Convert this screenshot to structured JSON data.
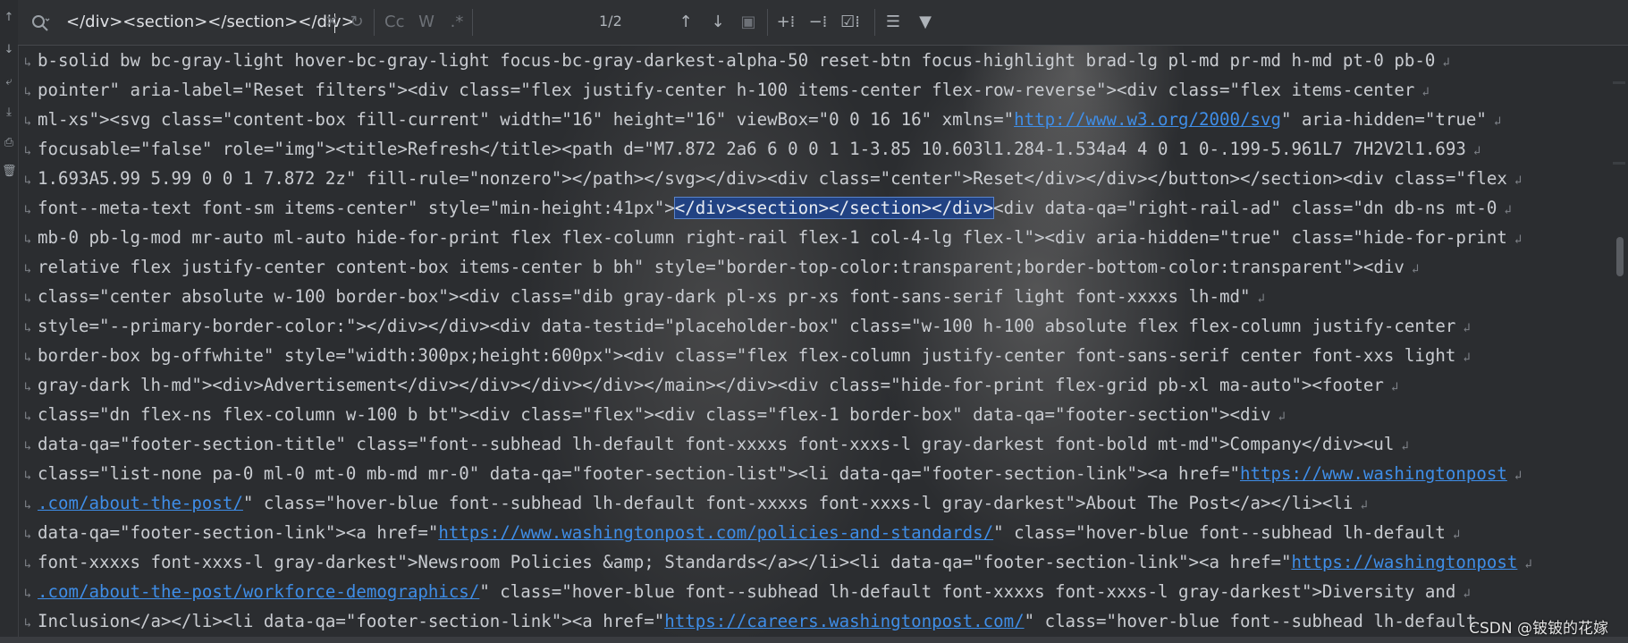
{
  "search": {
    "query": "</div><section></section></div>",
    "match_count": "1/2",
    "buttons": {
      "match_case": "Cc",
      "words": "W",
      "regex": ".*"
    }
  },
  "code_lines": [
    "b-solid bw bc-gray-light hover-bc-gray-light focus-bc-gray-darkest-alpha-50 reset-btn focus-highlight brad-lg pl-md pr-md h-md pt-0 pb-0",
    "pointer\" aria-label=\"Reset filters\"><div class=\"flex justify-center h-100 items-center flex-row-reverse\"><div class=\"flex items-center",
    "ml-xs\"><svg class=\"content-box fill-current\" width=\"16\" height=\"16\" viewBox=\"0 0 16 16\" xmlns=\"",
    "focusable=\"false\" role=\"img\"><title>Refresh</title><path d=\"M7.872 2a6 6 0 0 1 1-3.85 10.603l1.284-1.534a4 4 0 1 0-.199-5.961L7 7H2V2l1.693",
    "1.693A5.99 5.99 0 0 1 7.872 2z\" fill-rule=\"nonzero\"></path></svg></div><div class=\"center\">Reset</div></div></button></section><div class=\"flex",
    "font--meta-text font-sm items-center\" style=\"min-height:41px\">",
    "mb-0 pb-lg-mod mr-auto ml-auto hide-for-print flex flex-column right-rail flex-1 col-4-lg flex-l\"><div aria-hidden=\"true\" class=\"hide-for-print",
    "relative flex justify-center content-box items-center b bh\" style=\"border-top-color:transparent;border-bottom-color:transparent\"><div",
    "class=\"center absolute w-100 border-box\"><div class=\"dib gray-dark pl-xs pr-xs font-sans-serif light font-xxxxs lh-md\"",
    "style=\"--primary-border-color:\"></div></div><div data-testid=\"placeholder-box\" class=\"w-100 h-100 absolute flex flex-column justify-center",
    "border-box bg-offwhite\" style=\"width:300px;height:600px\"><div class=\"flex flex-column justify-center font-sans-serif center font-xxs light",
    "gray-dark lh-md\"><div>Advertisement</div></div></div></div></main></div><div class=\"hide-for-print flex-grid pb-xl ma-auto\"><footer",
    "class=\"dn flex-ns flex-column w-100 b bt\"><div class=\"flex\"><div class=\"flex-1 border-box\" data-qa=\"footer-section\"><div",
    "data-qa=\"footer-section-title\" class=\"font--subhead lh-default font-xxxxs font-xxxs-l gray-darkest font-bold mt-md\">Company</div><ul",
    "class=\"list-none pa-0 ml-0 mt-0 mb-md mr-0\" data-qa=\"footer-section-list\"><li data-qa=\"footer-section-link\"><a href=\"",
    "\" class=\"hover-blue font--subhead lh-default font-xxxxs font-xxxs-l gray-darkest\">About The Post</a></li><li",
    "data-qa=\"footer-section-link\"><a href=\"",
    "font-xxxxs font-xxxs-l gray-darkest\">Newsroom Policies &amp; Standards</a></li><li data-qa=\"footer-section-link\"><a href=\"",
    "\" class=\"hover-blue font--subhead lh-default font-xxxxs font-xxxs-l gray-darkest\">Diversity and",
    "Inclusion</a></li><li data-qa=\"footer-section-link\"><a href=\""
  ],
  "code_parts": {
    "l2_link": "http://www.w3.org/2000/svg",
    "l2_tail": "\" aria-hidden=\"true\"",
    "l5_match": "</div><section></section></div>",
    "l5_tail": "<div data-qa=\"right-rail-ad\" class=\"dn db-ns mt-0",
    "l14_link": "https://www.washingtonpost",
    "l15_link": ".com/about-the-post/",
    "l16_link": "https://www.washingtonpost.com/policies-and-standards/",
    "l16_tail": "\" class=\"hover-blue font--subhead lh-default",
    "l17_link": "https://washingtonpost",
    "l18_link": ".com/about-the-post/workforce-demographics/",
    "l19_link": "https://careers.washingtonpost.com/",
    "l19_tail": "\" class=\"hover-blue font--subhead lh-default"
  },
  "watermark": "CSDN @铍铍的花嫁",
  "icons": {
    "search": "magnifier-icon",
    "clear": "close-icon",
    "history": "history-icon",
    "prev": "arrow-up-icon",
    "next": "arrow-down-icon",
    "select_all": "select-all-icon",
    "add_selection": "add-selection-icon",
    "remove_selection": "remove-selection-icon",
    "toggle_selection": "toggle-selection-icon",
    "filter_lines": "filter-lines-icon",
    "filter": "filter-icon"
  },
  "colors": {
    "background": "#2b2d30",
    "link": "#3f8ee8",
    "match_highlight": "#214283",
    "text": "#c9ccd1"
  }
}
